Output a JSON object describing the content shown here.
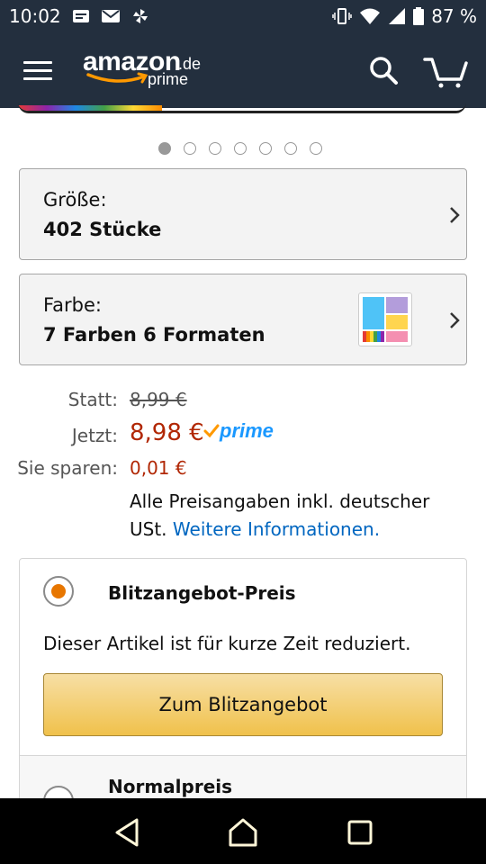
{
  "status_bar": {
    "time": "10:02",
    "battery": "87 %"
  },
  "header": {
    "logo_text": "amazon",
    "logo_tld": ".de",
    "logo_prime": "prime"
  },
  "carousel": {
    "dot_count": 7,
    "active_index": 0
  },
  "variations": {
    "size": {
      "label": "Größe:",
      "value": "402 Stücke"
    },
    "color": {
      "label": "Farbe:",
      "value": "7 Farben 6 Formaten"
    }
  },
  "price": {
    "was_label": "Statt:",
    "was_value": "8,99 €",
    "now_label": "Jetzt:",
    "now_value": "8,98 €",
    "prime_label": "prime",
    "save_label": "Sie sparen:",
    "save_value": "0,01 €",
    "note_text": "Alle Preisangaben inkl. deutscher USt.",
    "note_link": "Weitere Informationen."
  },
  "buybox": {
    "deal_title": "Blitzangebot-Preis",
    "deal_desc": "Dieser Artikel ist für kurze Zeit reduziert.",
    "deal_button": "Zum Blitzangebot",
    "normal_title": "Normalpreis"
  },
  "colors": {
    "header_bg": "#232f3e",
    "price_red": "#b12704",
    "link_blue": "#0066c0",
    "prime_blue": "#1a98ff",
    "radio_orange": "#e77600",
    "button_yellow": "#f0c14b"
  }
}
